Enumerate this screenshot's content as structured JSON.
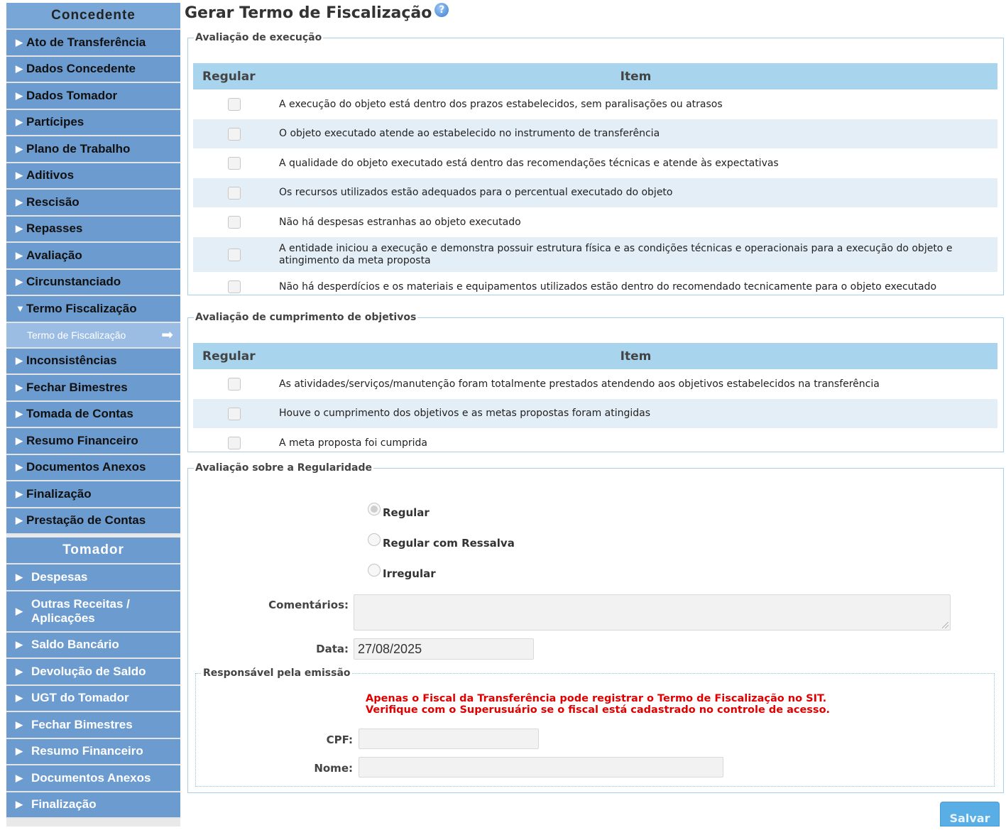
{
  "sidebar": {
    "concedente_title": "Concedente",
    "concedente_items": [
      "Ato de Transferência",
      "Dados Concedente",
      "Dados Tomador",
      "Partícipes",
      "Plano de Trabalho",
      "Aditivos",
      "Rescisão",
      "Repasses",
      "Avaliação",
      "Circunstanciado",
      "Termo Fiscalização",
      "Inconsistências",
      "Fechar Bimestres",
      "Tomada de Contas",
      "Resumo Financeiro",
      "Documentos Anexos",
      "Finalização",
      "Prestação de Contas"
    ],
    "active_sub": "Termo de Fiscalização",
    "tomador_title": "Tomador",
    "tomador_items": [
      "Despesas",
      "Outras Receitas / Aplicações",
      "Saldo Bancário",
      "Devolução de Saldo",
      "UGT do Tomador",
      "Fechar Bimestres",
      "Resumo Financeiro",
      "Documentos Anexos",
      "Finalização"
    ]
  },
  "page": {
    "title": "Gerar Termo de Fiscalização",
    "help_icon": "question-circle-icon"
  },
  "execucao": {
    "legend": "Avaliação de execução",
    "col_regular": "Regular",
    "col_item": "Item",
    "items": [
      "A execução do objeto está dentro dos prazos estabelecidos, sem paralisações ou atrasos",
      "O objeto executado atende ao estabelecido no instrumento de transferência",
      "A qualidade do objeto executado está dentro das recomendações técnicas e atende às expectativas",
      "Os recursos utilizados estão adequados para o percentual executado do objeto",
      "Não há despesas estranhas ao objeto executado",
      "A entidade iniciou a execução e demonstra possuir estrutura física e as condições técnicas e operacionais para a execução do objeto e atingimento da meta proposta",
      "Não há desperdícios e os materiais e equipamentos utilizados estão dentro do recomendado tecnicamente para o objeto executado"
    ]
  },
  "objetivos": {
    "legend": "Avaliação de cumprimento de objetivos",
    "col_regular": "Regular",
    "col_item": "Item",
    "items": [
      "As atividades/serviços/manutenção foram totalmente prestados atendendo aos objetivos estabelecidos na transferência",
      "Houve o cumprimento dos objetivos e as metas propostas foram atingidas",
      "A meta proposta foi cumprida"
    ]
  },
  "regularidade": {
    "legend": "Avaliação sobre a Regularidade",
    "options": [
      "Regular",
      "Regular com Ressalva",
      "Irregular"
    ],
    "selected": "Regular",
    "comentarios_label": "Comentários:",
    "comentarios_value": "",
    "data_label": "Data:",
    "data_value": "27/08/2025"
  },
  "responsavel": {
    "legend": "Responsável pela emissão",
    "warning_line1": "Apenas o Fiscal da Transferência pode registrar o Termo de Fiscalização no SIT.",
    "warning_line2": "Verifique com o Superusuário se o fiscal está cadastrado no controle de acesso.",
    "cpf_label": "CPF:",
    "cpf_value": "",
    "nome_label": "Nome:",
    "nome_value": ""
  },
  "actions": {
    "save_label": "Salvar"
  },
  "colors": {
    "nav_blue": "#6b9bcf",
    "header_blue": "#a9d4ee",
    "warning_red": "#e10000",
    "save_blue": "#5aaee6"
  }
}
